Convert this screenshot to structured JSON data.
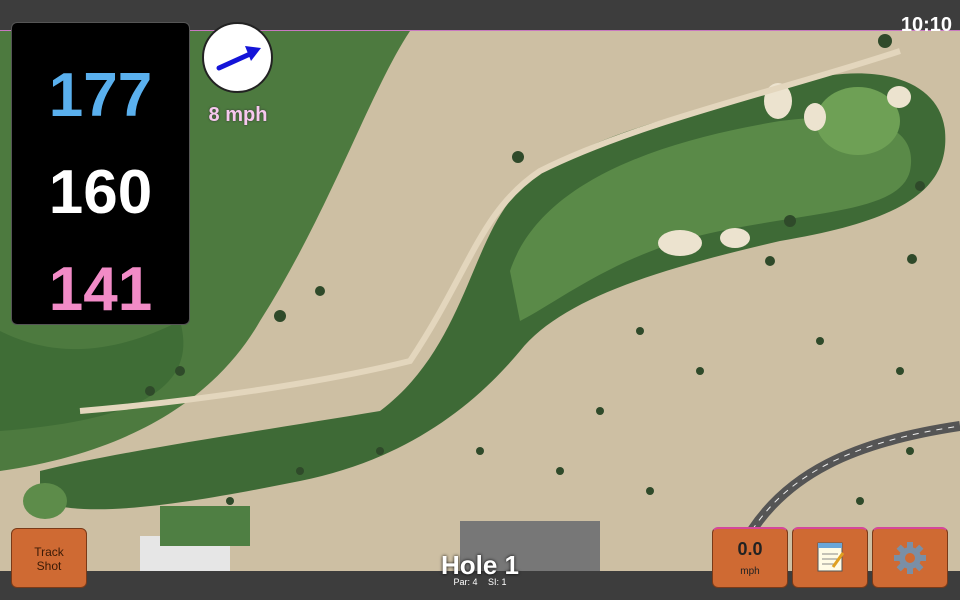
{
  "status": {
    "time": "10:10"
  },
  "distances": {
    "back": "177",
    "middle": "160",
    "front": "141"
  },
  "wind": {
    "speed_label": "8 mph",
    "icon": "wind-direction-arrow-icon"
  },
  "buttons": {
    "track_shot_line1": "Track",
    "track_shot_line2": "Shot",
    "speed_value": "0.0",
    "speed_unit": "mph",
    "notes_icon": "notepad-icon",
    "settings_icon": "gear-icon"
  },
  "hole": {
    "title": "Hole 1",
    "par": "Par: 4",
    "si": "SI: 1"
  },
  "colors": {
    "back_distance": "#5ab0ee",
    "middle_distance": "#ffffff",
    "front_distance": "#f28bc7",
    "button": "#cf6a33",
    "fairway": "#4a7a3e",
    "sand": "#cdbfa3"
  }
}
